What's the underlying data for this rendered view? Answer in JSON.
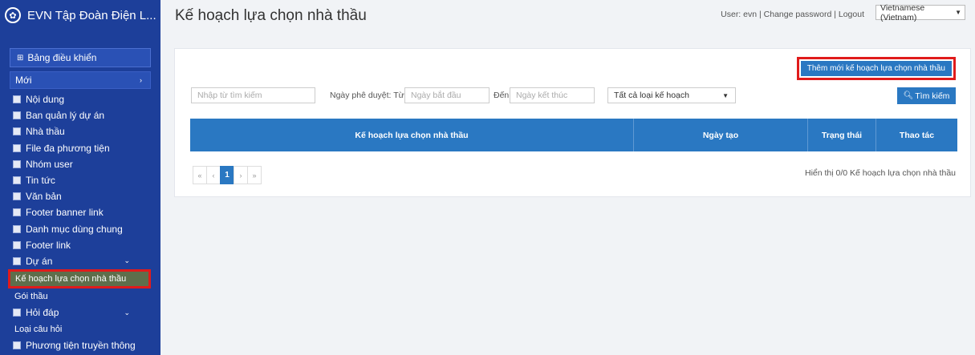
{
  "app": {
    "title": "EVN Tập Đoàn Điện L...",
    "logo_icon": "evn-logo-icon"
  },
  "sidebar": {
    "dashboard": "Bảng điều khiển",
    "group": "Mới",
    "items": [
      {
        "label": "Nội dung"
      },
      {
        "label": "Ban quản lý dự án"
      },
      {
        "label": "Nhà thầu"
      },
      {
        "label": "File đa phương tiện"
      },
      {
        "label": "Nhóm user"
      },
      {
        "label": "Tin tức"
      },
      {
        "label": "Văn bản"
      },
      {
        "label": "Footer banner link"
      },
      {
        "label": "Danh mục dùng chung"
      },
      {
        "label": "Footer link"
      },
      {
        "label": "Dự án"
      },
      {
        "label": "Kế hoạch lựa chọn nhà thầu"
      },
      {
        "label": "Gói thầu"
      },
      {
        "label": "Hỏi đáp"
      },
      {
        "label": "Loại câu hỏi"
      },
      {
        "label": "Phương tiện truyền thông"
      }
    ]
  },
  "header": {
    "page_title": "Kế hoạch lựa chọn nhà thầu",
    "user_text": "User: evn",
    "change_password": "Change password",
    "logout": "Logout",
    "language": "Vietnamese (Vietnam)"
  },
  "toolbar": {
    "add_label": "Thêm mới kế hoạch lựa chọn nhà thầu"
  },
  "filters": {
    "keyword_placeholder": "Nhập từ tìm kiếm",
    "date_label": "Ngày phê duyệt: Từ",
    "start_placeholder": "Ngày bắt đầu",
    "to_label": "Đến",
    "end_placeholder": "Ngày kết thúc",
    "plan_type": "Tất cả loại kế hoạch",
    "search_label": "Tìm kiếm"
  },
  "table": {
    "columns": [
      "Kế hoạch lựa chọn nhà thầu",
      "Ngày tạo",
      "Trạng thái",
      "Thao tác"
    ]
  },
  "pagination": {
    "first": "«",
    "prev": "‹",
    "page": "1",
    "next": "›",
    "last": "»"
  },
  "summary": "Hiển thị 0/0 Kế hoạch lựa chọn nhà thầu",
  "colors": {
    "sidebar": "#1d3f9a",
    "primary": "#2a78c2",
    "highlight": "#e01b1b"
  }
}
